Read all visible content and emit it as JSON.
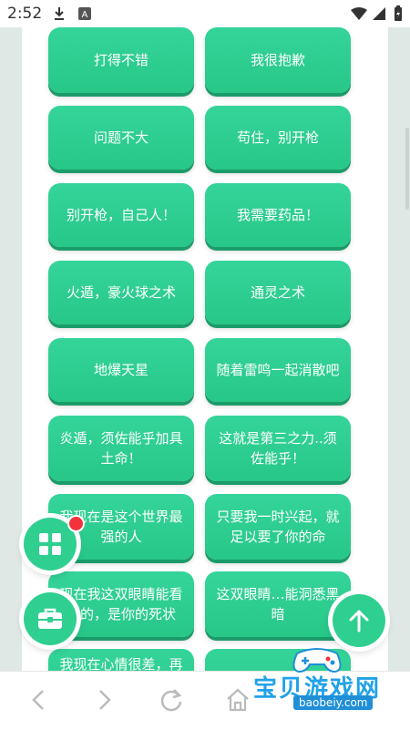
{
  "status_bar": {
    "time": "2:52",
    "icons": [
      "download-icon",
      "a-app-icon",
      "wifi-icon",
      "signal-icon",
      "battery-icon"
    ]
  },
  "phrases": [
    {
      "text": "打得不错"
    },
    {
      "text": "我很抱歉"
    },
    {
      "text": "问题不大"
    },
    {
      "text": "苟住，别开枪"
    },
    {
      "text": "别开枪，自己人！"
    },
    {
      "text": "我需要药品！"
    },
    {
      "text": "火遁，豪火球之术"
    },
    {
      "text": "通灵之术"
    },
    {
      "text": "地爆天星"
    },
    {
      "text": "随着雷鸣一起消散吧"
    },
    {
      "text": "炎遁，须佐能乎加具土命！"
    },
    {
      "text": "这就是第三之力..须佐能乎！"
    },
    {
      "text": "我现在是这个世界最强的人"
    },
    {
      "text": "只要我一时兴起，就足以要了你的命"
    },
    {
      "text": "现在我这双眼睛能看到的，是你的死状"
    },
    {
      "text": "这双眼睛…能洞悉黑暗"
    },
    {
      "text": "我现在心情很差，再"
    },
    {
      "text": ""
    }
  ],
  "fabs": {
    "grid_icon": "grid-icon",
    "toolbox_icon": "toolbox-icon",
    "scroll_top_icon": "arrow-up-icon"
  },
  "nav": {
    "items": [
      "back-icon",
      "forward-icon",
      "refresh-icon",
      "home-icon"
    ]
  },
  "watermark": {
    "title": "宝贝游戏网",
    "url": "baobeiy.com"
  },
  "colors": {
    "accent": "#2fcf90",
    "button_shadow": "#1c9b6a",
    "badge": "#f2333c"
  }
}
